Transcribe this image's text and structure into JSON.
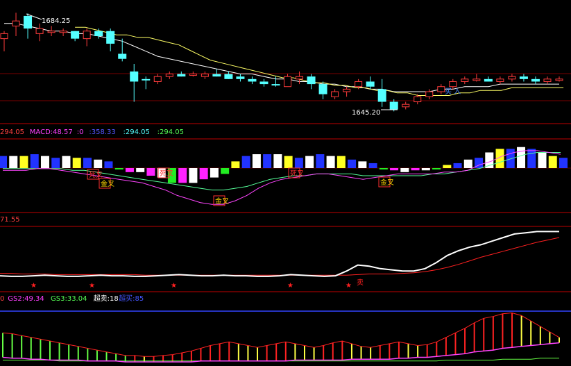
{
  "chart_data": [
    {
      "type": "candlestick",
      "panel": "price",
      "annotations": {
        "high_label": "1684.25",
        "low_label": "1645.20",
        "buy_label": "买 入"
      },
      "candles": [
        {
          "o": 1674,
          "h": 1677,
          "l": 1669,
          "c": 1676,
          "up": true
        },
        {
          "o": 1679,
          "h": 1684.25,
          "l": 1675,
          "c": 1681,
          "up": true
        },
        {
          "o": 1683,
          "h": 1684,
          "l": 1674,
          "c": 1678,
          "up": false
        },
        {
          "o": 1676,
          "h": 1680,
          "l": 1673,
          "c": 1678,
          "up": true
        },
        {
          "o": 1677,
          "h": 1679,
          "l": 1675,
          "c": 1677,
          "up": true
        },
        {
          "o": 1677,
          "h": 1678,
          "l": 1675,
          "c": 1677,
          "up": true
        },
        {
          "o": 1677,
          "h": 1677,
          "l": 1673,
          "c": 1674,
          "up": false
        },
        {
          "o": 1674,
          "h": 1678,
          "l": 1671,
          "c": 1677,
          "up": true
        },
        {
          "o": 1677,
          "h": 1678,
          "l": 1674,
          "c": 1675,
          "up": false
        },
        {
          "o": 1677,
          "h": 1678,
          "l": 1669,
          "c": 1672,
          "up": false
        },
        {
          "o": 1668,
          "h": 1674,
          "l": 1665,
          "c": 1666,
          "up": false
        },
        {
          "o": 1661,
          "h": 1664,
          "l": 1649,
          "c": 1657,
          "up": false
        },
        {
          "o": 1658,
          "h": 1659,
          "l": 1654,
          "c": 1658,
          "up": false
        },
        {
          "o": 1657,
          "h": 1660,
          "l": 1656,
          "c": 1659,
          "up": true
        },
        {
          "o": 1659,
          "h": 1661,
          "l": 1658,
          "c": 1660,
          "up": true
        },
        {
          "o": 1660,
          "h": 1661,
          "l": 1659,
          "c": 1659,
          "up": false
        },
        {
          "o": 1660,
          "h": 1661,
          "l": 1659,
          "c": 1660,
          "up": true
        },
        {
          "o": 1659,
          "h": 1661,
          "l": 1658,
          "c": 1660,
          "up": true
        },
        {
          "o": 1660,
          "h": 1662,
          "l": 1659,
          "c": 1659,
          "up": false
        },
        {
          "o": 1660,
          "h": 1661,
          "l": 1658,
          "c": 1658,
          "up": false
        },
        {
          "o": 1659,
          "h": 1660,
          "l": 1657,
          "c": 1658,
          "up": false
        },
        {
          "o": 1658,
          "h": 1659,
          "l": 1656,
          "c": 1657,
          "up": false
        },
        {
          "o": 1657,
          "h": 1658,
          "l": 1655,
          "c": 1656,
          "up": false
        },
        {
          "o": 1656,
          "h": 1659,
          "l": 1655,
          "c": 1656,
          "up": false
        },
        {
          "o": 1655,
          "h": 1660,
          "l": 1655,
          "c": 1659,
          "up": true
        },
        {
          "o": 1658,
          "h": 1661,
          "l": 1656,
          "c": 1659,
          "up": true
        },
        {
          "o": 1659,
          "h": 1660,
          "l": 1654,
          "c": 1656,
          "up": false
        },
        {
          "o": 1656,
          "h": 1657,
          "l": 1650,
          "c": 1652,
          "up": false
        },
        {
          "o": 1651,
          "h": 1654,
          "l": 1650,
          "c": 1653,
          "up": true
        },
        {
          "o": 1653,
          "h": 1655,
          "l": 1651,
          "c": 1654,
          "up": true
        },
        {
          "o": 1655,
          "h": 1658,
          "l": 1654,
          "c": 1657,
          "up": true
        },
        {
          "o": 1655,
          "h": 1659,
          "l": 1654,
          "c": 1657,
          "up": false
        },
        {
          "o": 1654,
          "h": 1658,
          "l": 1647,
          "c": 1649,
          "up": false
        },
        {
          "o": 1649,
          "h": 1650,
          "l": 1645.2,
          "c": 1646,
          "up": false
        },
        {
          "o": 1647,
          "h": 1649,
          "l": 1646,
          "c": 1648,
          "up": true
        },
        {
          "o": 1649,
          "h": 1652,
          "l": 1648,
          "c": 1651,
          "up": true
        },
        {
          "o": 1651,
          "h": 1654,
          "l": 1650,
          "c": 1653,
          "up": true
        },
        {
          "o": 1653,
          "h": 1656,
          "l": 1652,
          "c": 1655,
          "up": true
        },
        {
          "o": 1655,
          "h": 1658,
          "l": 1654,
          "c": 1657,
          "up": true
        },
        {
          "o": 1657,
          "h": 1659,
          "l": 1656,
          "c": 1658,
          "up": true
        },
        {
          "o": 1658,
          "h": 1660,
          "l": 1657,
          "c": 1658,
          "up": true
        },
        {
          "o": 1658,
          "h": 1659,
          "l": 1657,
          "c": 1657,
          "up": false
        },
        {
          "o": 1657,
          "h": 1659,
          "l": 1656,
          "c": 1658,
          "up": true
        },
        {
          "o": 1658,
          "h": 1660,
          "l": 1657,
          "c": 1659,
          "up": true
        },
        {
          "o": 1659,
          "h": 1660,
          "l": 1657,
          "c": 1658,
          "up": false
        },
        {
          "o": 1658,
          "h": 1659,
          "l": 1656,
          "c": 1657,
          "up": false
        },
        {
          "o": 1657,
          "h": 1659,
          "l": 1656,
          "c": 1658,
          "up": true
        },
        {
          "o": 1658,
          "h": 1659,
          "l": 1657,
          "c": 1658,
          "up": true
        }
      ],
      "ma": [
        1680,
        1680,
        1679,
        1678,
        1677,
        1677,
        1676,
        1676,
        1675,
        1674,
        1673,
        1671,
        1669,
        1667,
        1666,
        1665,
        1664,
        1663,
        1662,
        1661,
        1660,
        1660,
        1659,
        1658,
        1658,
        1657,
        1657,
        1656,
        1656,
        1655,
        1655,
        1654,
        1654,
        1653,
        1653,
        1653,
        1653,
        1654,
        1654,
        1655,
        1655,
        1655,
        1656,
        1656,
        1656,
        1656,
        1656,
        1656
      ],
      "ylim": [
        1642,
        1686
      ],
      "colors": {
        "up": "#ff3c3c",
        "down": "#54ffff",
        "ma": "#ffffff",
        "ma2": "#ffff66"
      }
    },
    {
      "type": "bar+line",
      "panel": "macd",
      "header": [
        {
          "text": "294.05",
          "color": "#ff4040"
        },
        {
          "text": "MACD:48.57",
          "color": "#ff40ff"
        },
        {
          "text": ":0",
          "color": "#ff40ff"
        },
        {
          "text": ":358.33",
          "color": "#5555ff"
        },
        {
          "text": ":294.05",
          "color": "#55ffff"
        },
        {
          "text": ":294.05",
          "color": "#55ff55"
        }
      ],
      "bars": [
        6,
        6,
        6,
        7,
        6,
        5,
        6,
        5,
        5,
        4,
        3,
        -1,
        -3,
        -3,
        -5,
        -6,
        -9,
        -9,
        -9,
        -7,
        -6,
        -4,
        3,
        6,
        7,
        7,
        7,
        6,
        5,
        6,
        7,
        6,
        6,
        4,
        3,
        2,
        -1,
        -2,
        -3,
        -2,
        -2,
        -1,
        1,
        2,
        4,
        5,
        8,
        10,
        10,
        11,
        10,
        8,
        6,
        5
      ],
      "dif": [
        -2,
        -2,
        -2,
        -1,
        -1,
        -2,
        -3,
        -4,
        -5,
        -6,
        -7,
        -8,
        -9,
        -11,
        -13,
        -16,
        -18,
        -20,
        -21,
        -21,
        -19,
        -16,
        -12,
        -9,
        -7,
        -6,
        -5,
        -4,
        -4,
        -5,
        -6,
        -7,
        -6,
        -5,
        -4,
        -4,
        -4,
        -4,
        -3,
        -3,
        -2,
        1,
        3,
        6,
        8,
        9,
        9,
        8,
        7
      ],
      "dea": [
        -1,
        -1,
        -1,
        -1,
        -1,
        -1,
        -2,
        -2,
        -3,
        -4,
        -5,
        -6,
        -7,
        -8,
        -9,
        -10,
        -11,
        -12,
        -13,
        -13,
        -12,
        -11,
        -9,
        -7,
        -6,
        -5,
        -5,
        -4,
        -4,
        -4,
        -4,
        -5,
        -5,
        -5,
        -5,
        -5,
        -5,
        -4,
        -4,
        -3,
        -2,
        -1,
        1,
        3,
        5,
        7,
        8,
        8,
        8
      ],
      "labels": [
        "死叉",
        "金叉",
        "死叉",
        "金叉",
        "死叉",
        "金叉"
      ],
      "ylim": [
        -24,
        14
      ],
      "colors": {
        "dif": "#ff44ff",
        "dea": "#55ff99"
      }
    },
    {
      "type": "line",
      "panel": "indicator",
      "header": [
        {
          "text": "71.55",
          "color": "#ff4040"
        }
      ],
      "white": [
        22,
        21,
        21,
        22,
        23,
        22,
        21,
        21,
        22,
        23,
        22,
        22,
        21,
        21,
        22,
        23,
        24,
        23,
        22,
        22,
        23,
        22,
        22,
        21,
        21,
        22,
        24,
        23,
        22,
        21,
        22,
        30,
        40,
        38,
        34,
        32,
        30,
        30,
        34,
        44,
        56,
        64,
        70,
        74,
        80,
        86,
        92,
        94,
        96,
        96,
        96
      ],
      "red": [
        26,
        26,
        25,
        25,
        25,
        24,
        24,
        24,
        24,
        24,
        24,
        24,
        24,
        23,
        23,
        23,
        23,
        23,
        23,
        23,
        23,
        23,
        23,
        23,
        23,
        23,
        23,
        23,
        23,
        23,
        23,
        23,
        24,
        25,
        25,
        25,
        26,
        27,
        29,
        32,
        36,
        41,
        47,
        53,
        58,
        63,
        68,
        73,
        78,
        82,
        86
      ],
      "signals": [
        "卖"
      ],
      "ylim": [
        0,
        100
      ],
      "colors": {
        "white": "#ffffff",
        "red": "#ff2020",
        "star": "#ff2020"
      }
    },
    {
      "type": "bar+line",
      "panel": "oscillator",
      "header": [
        {
          "text": "0",
          "color": "#ff4040"
        },
        {
          "text": "GS2:49.34",
          "color": "#ff40ff"
        },
        {
          "text": "GS3:33.04",
          "color": "#55ff55"
        },
        {
          "text": "超卖:18",
          "color": "#ffffff"
        },
        {
          "text": "超买:85",
          "color": "#4455ff"
        }
      ],
      "gs1": [
        45,
        44,
        42,
        40,
        38,
        36,
        34,
        32,
        30,
        28,
        26,
        24,
        22,
        20,
        20,
        19,
        19,
        20,
        21,
        23,
        25,
        28,
        31,
        33,
        35,
        33,
        31,
        29,
        31,
        33,
        35,
        33,
        31,
        29,
        31,
        34,
        36,
        33,
        30,
        29,
        31,
        33,
        35,
        33,
        31,
        32,
        35,
        40,
        45,
        50,
        56,
        61,
        63,
        66,
        67,
        64,
        58,
        52,
        46,
        40
      ],
      "gs2": [
        18,
        17,
        17,
        16,
        16,
        15,
        15,
        15,
        15,
        14,
        14,
        14,
        14,
        13,
        13,
        13,
        13,
        13,
        13,
        13,
        13,
        14,
        14,
        14,
        14,
        14,
        14,
        14,
        14,
        14,
        14,
        15,
        15,
        15,
        15,
        15,
        15,
        16,
        16,
        16,
        16,
        16,
        17,
        17,
        18,
        18,
        19,
        20,
        21,
        22,
        24,
        25,
        26,
        28,
        29,
        30,
        31,
        32,
        33,
        34
      ],
      "gs3": [
        15,
        15,
        15,
        15,
        15,
        15,
        14,
        14,
        14,
        14,
        14,
        14,
        14,
        14,
        14,
        14,
        14,
        14,
        14,
        14,
        14,
        14,
        14,
        14,
        14,
        14,
        14,
        14,
        14,
        14,
        14,
        14,
        14,
        14,
        14,
        14,
        14,
        14,
        14,
        14,
        14,
        14,
        14,
        14,
        14,
        14,
        14,
        15,
        15,
        15,
        15,
        15,
        15,
        16,
        16,
        16,
        16,
        17,
        17,
        17
      ],
      "ylim": [
        10,
        75
      ],
      "colors": {
        "green": "#66ff44",
        "red": "#ff2222",
        "yellow": "#ffff44",
        "magenta": "#ff44ff",
        "blue": "#3344ff"
      }
    }
  ]
}
